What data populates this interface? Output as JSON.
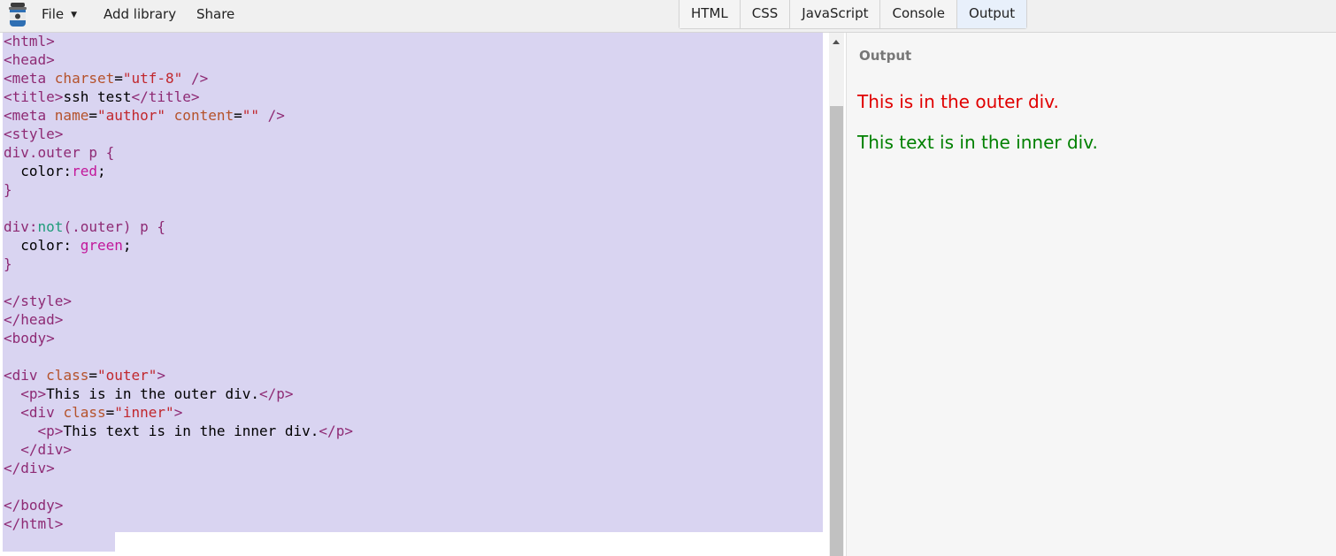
{
  "menu": {
    "file": "File",
    "add_library": "Add library",
    "share": "Share"
  },
  "icons": {
    "logo": "jar-logo-icon",
    "file_caret": "caret-down-icon"
  },
  "tabs": [
    "HTML",
    "CSS",
    "JavaScript",
    "Console",
    "Output"
  ],
  "active_tab": "Output",
  "editor": {
    "lines": [
      [
        [
          "t",
          "<html>"
        ]
      ],
      [
        [
          "t",
          "<head>"
        ]
      ],
      [
        [
          "t",
          "<meta "
        ],
        [
          "a",
          "charset"
        ],
        [
          "",
          "="
        ],
        [
          "s",
          "\"utf-8\""
        ],
        [
          "t",
          " />"
        ]
      ],
      [
        [
          "t",
          "<title>"
        ],
        [
          "",
          "ssh test"
        ],
        [
          "t",
          "</title>"
        ]
      ],
      [
        [
          "t",
          "<meta "
        ],
        [
          "a",
          "name"
        ],
        [
          "",
          "="
        ],
        [
          "s",
          "\"author\""
        ],
        [
          "",
          " "
        ],
        [
          "a",
          "content"
        ],
        [
          "",
          "="
        ],
        [
          "s",
          "\"\""
        ],
        [
          "t",
          " />"
        ]
      ],
      [
        [
          "t",
          "<style>"
        ]
      ],
      [
        [
          "t",
          "div.outer p {"
        ]
      ],
      [
        [
          "",
          "  color:"
        ],
        [
          "v",
          "red"
        ],
        [
          "",
          ";"
        ]
      ],
      [
        [
          "t",
          "}"
        ]
      ],
      [],
      [
        [
          "t",
          "div:"
        ],
        [
          "k",
          "not"
        ],
        [
          "t",
          "(.outer) p {"
        ]
      ],
      [
        [
          "",
          "  color: "
        ],
        [
          "v",
          "green"
        ],
        [
          "",
          ";"
        ]
      ],
      [
        [
          "t",
          "}"
        ]
      ],
      [],
      [
        [
          "t",
          "</style>"
        ]
      ],
      [
        [
          "t",
          "</head>"
        ]
      ],
      [
        [
          "t",
          "<body>"
        ]
      ],
      [],
      [
        [
          "t",
          "<div "
        ],
        [
          "a",
          "class"
        ],
        [
          "",
          "="
        ],
        [
          "s",
          "\"outer\""
        ],
        [
          "t",
          ">"
        ]
      ],
      [
        [
          "",
          "  "
        ],
        [
          "t",
          "<p>"
        ],
        [
          "",
          "This is in the outer div."
        ],
        [
          "t",
          "</p>"
        ]
      ],
      [
        [
          "",
          "  "
        ],
        [
          "t",
          "<div "
        ],
        [
          "a",
          "class"
        ],
        [
          "",
          "="
        ],
        [
          "s",
          "\"inner\""
        ],
        [
          "t",
          ">"
        ]
      ],
      [
        [
          "",
          "    "
        ],
        [
          "t",
          "<p>"
        ],
        [
          "",
          "This text is in the inner div."
        ],
        [
          "t",
          "</p>"
        ]
      ],
      [
        [
          "",
          "  "
        ],
        [
          "t",
          "</div>"
        ]
      ],
      [
        [
          "t",
          "</div>"
        ]
      ],
      [],
      [
        [
          "t",
          "</body>"
        ]
      ],
      [
        [
          "t",
          "</html>"
        ]
      ]
    ],
    "token_colors": {
      "t": "#8e2a74",
      "a": "#b5522b",
      "s": "#c1272d",
      "k": "#1f9c7a",
      "v": "#c2179a"
    },
    "selection_color": "#d9d4f1"
  },
  "output": {
    "title": "Output",
    "outer_text": "This is in the outer div.",
    "inner_text": "This text is in the inner div.",
    "outer_color": "#e00000",
    "inner_color": "#008000"
  }
}
